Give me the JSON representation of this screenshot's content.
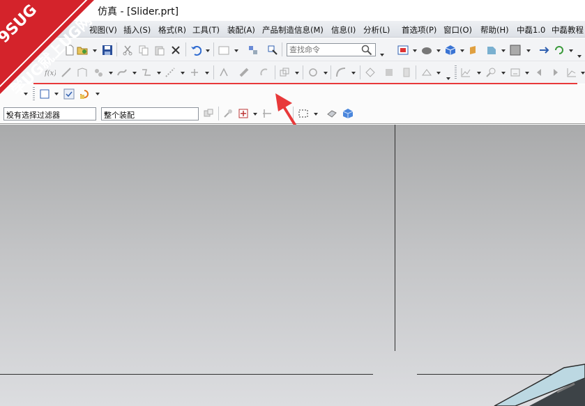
{
  "window": {
    "title": "仿真 - [Slider.prt]"
  },
  "watermark": {
    "line1": "9SUG",
    "line2": "学UG就上UG网"
  },
  "menu": [
    "视图(V)",
    "插入(S)",
    "格式(R)",
    "工具(T)",
    "装配(A)",
    "产品制造信息(M)",
    "信息(I)",
    "分析(L)",
    "首选项(P)",
    "窗口(O)",
    "帮助(H)",
    "中磊1.0",
    "中磊教程"
  ],
  "toolbar": {
    "search_placeholder": "查找命令"
  },
  "selection_bar": {
    "filter": "没有选择过滤器",
    "scope": "整个装配"
  },
  "colors": {
    "annotation": "#e8393a",
    "watermark": "#d4232b",
    "viewport_top": "#a9aaab",
    "viewport_bottom": "#dcdde0"
  },
  "icons": [
    "save-icon",
    "cut-icon",
    "copy-icon",
    "paste-icon",
    "delete-icon",
    "undo-icon",
    "search-icon",
    "view-orient-icon",
    "shaded-icon",
    "cube-icon",
    "snap-icon",
    "select-box-icon",
    "render-cube-icon"
  ]
}
